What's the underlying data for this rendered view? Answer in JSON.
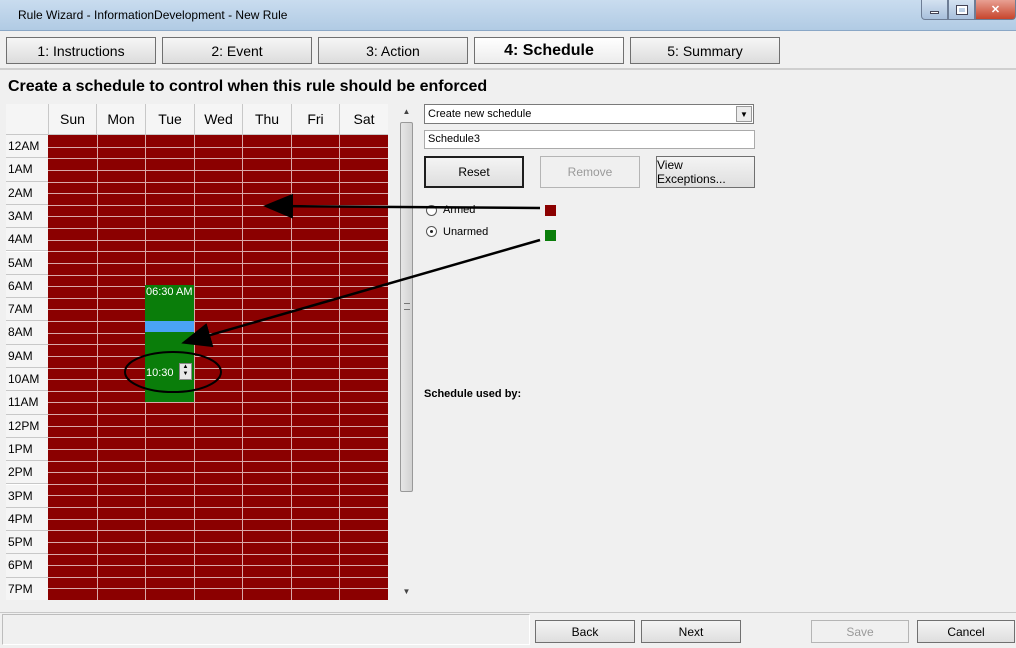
{
  "window": {
    "title": "Rule Wizard - InformationDevelopment - New Rule"
  },
  "tabs": [
    {
      "label": "1: Instructions"
    },
    {
      "label": "2: Event"
    },
    {
      "label": "3: Action"
    },
    {
      "label": "4: Schedule"
    },
    {
      "label": "5: Summary"
    }
  ],
  "active_tab": "4: Schedule",
  "heading": "Create a schedule to control when this rule should be enforced",
  "schedule_grid": {
    "days": [
      "Sun",
      "Mon",
      "Tue",
      "Wed",
      "Thu",
      "Fri",
      "Sat"
    ],
    "hours": [
      "12AM",
      "1AM",
      "2AM",
      "3AM",
      "4AM",
      "5AM",
      "6AM",
      "7AM",
      "8AM",
      "9AM",
      "10AM",
      "11AM",
      "12PM",
      "1PM",
      "2PM",
      "3PM",
      "4PM",
      "5PM",
      "6PM",
      "7PM"
    ],
    "selection_start_label": "06:30 AM",
    "selection_end_value": "10:30",
    "colors": {
      "armed": "#8b0000",
      "unarmed": "#0a7d0a",
      "selected_row": "#4aa3f5"
    }
  },
  "schedule_select": {
    "value": "Create new schedule"
  },
  "schedule_name": {
    "value": "Schedule3"
  },
  "buttons": {
    "reset": "Reset",
    "remove": "Remove",
    "view_exceptions": "View Exceptions..."
  },
  "legend": {
    "armed": "Armed",
    "unarmed": "Unarmed",
    "selected": "unarmed"
  },
  "schedule_used_by": "Schedule used by:",
  "footer": {
    "back": "Back",
    "next": "Next",
    "save": "Save",
    "cancel": "Cancel"
  }
}
